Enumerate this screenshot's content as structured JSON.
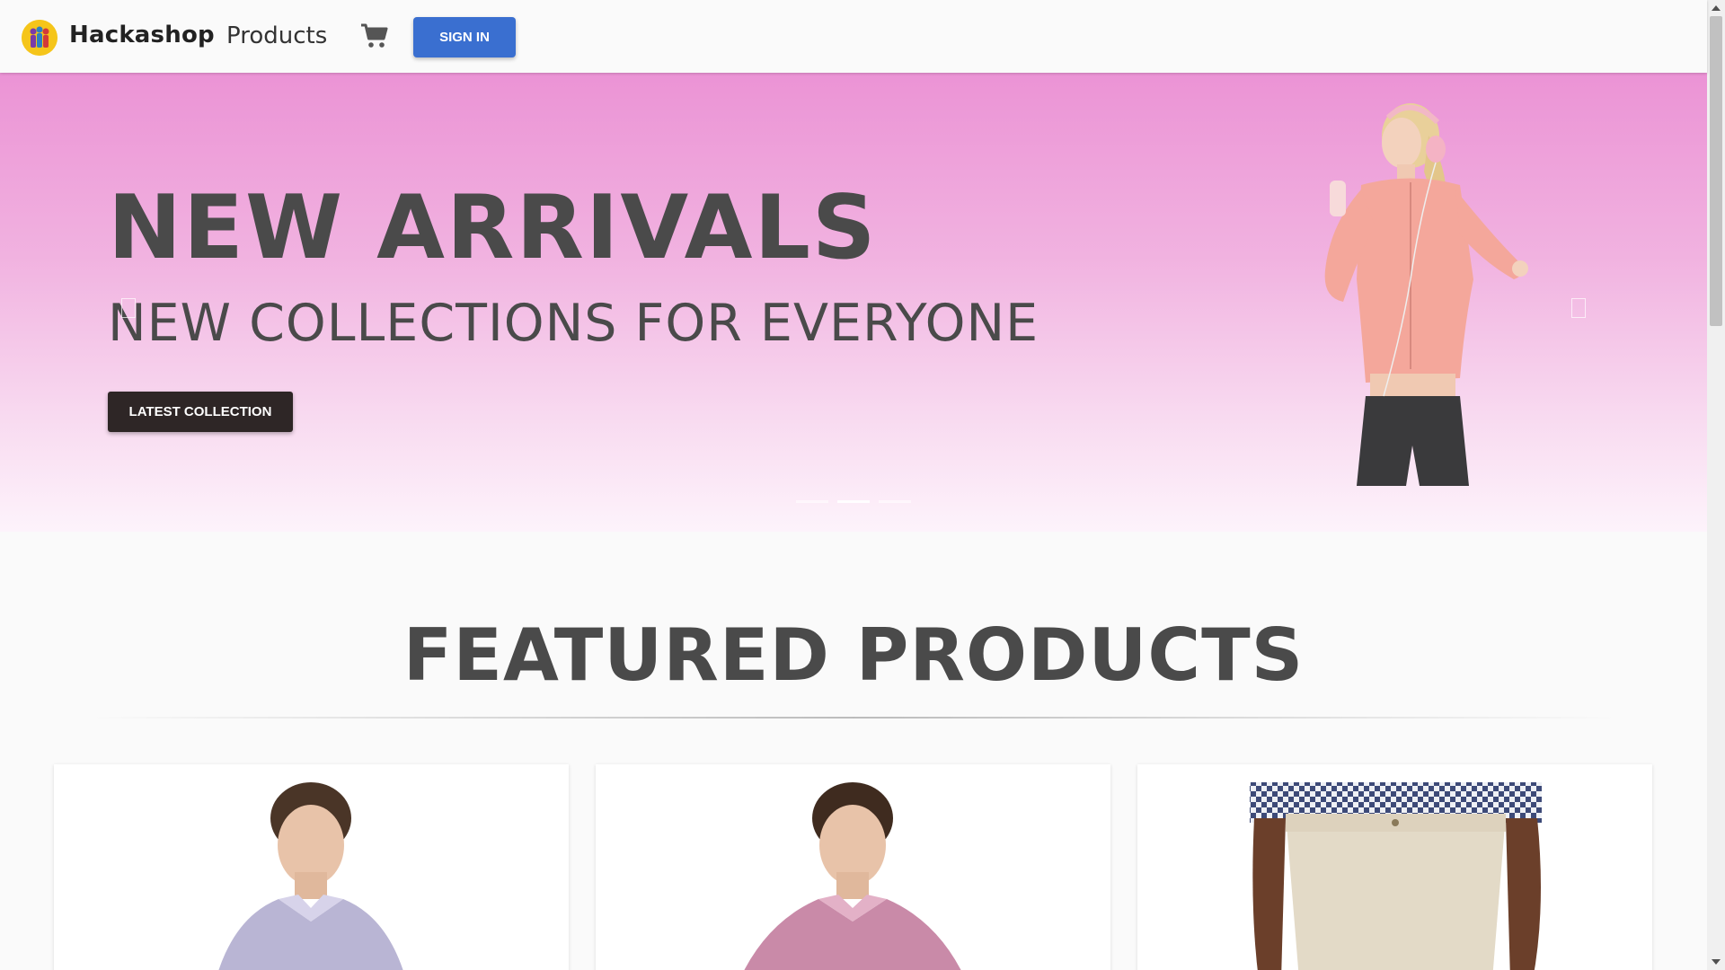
{
  "header": {
    "brand": "Hackashop",
    "nav_products": "Products",
    "signin_label": "SIGN IN",
    "logo_icon": "people-logo-icon",
    "cart_icon": "shopping-cart-icon"
  },
  "hero": {
    "title": "NEW ARRIVALS",
    "subtitle": "NEW COLLECTIONS FOR EVERYONE",
    "button_label": "LATEST COLLECTION",
    "prev_icon": "carousel-prev-icon",
    "next_icon": "carousel-next-icon",
    "slides_count": 3,
    "active_slide": 1
  },
  "featured": {
    "title": "FEATURED PRODUCTS"
  },
  "colors": {
    "primary_button": "#3a6fd0",
    "dark_button": "#2e2626",
    "hero_top": "#eb93d5",
    "hero_bottom": "#fdf3fb",
    "heading_text": "#4a4a4a"
  }
}
